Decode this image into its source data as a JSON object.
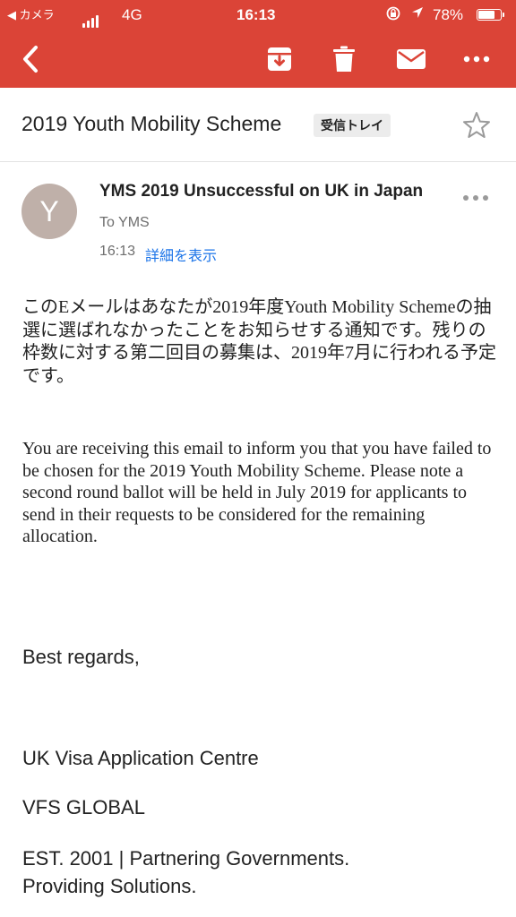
{
  "status_bar": {
    "back_app": "◀ カメラ",
    "network": "4G",
    "time": "16:13",
    "battery_pct": "78%",
    "battery_level": 0.78
  },
  "toolbar": {
    "icons": [
      "back-icon",
      "archive-icon",
      "trash-icon",
      "mail-icon",
      "more-horizontal-icon"
    ]
  },
  "email": {
    "subject": "2019 Youth Mobility Scheme",
    "label": "受信トレイ",
    "avatar_letter": "Y",
    "title": "YMS 2019 Unsuccessful on UK in Japan",
    "to": "To YMS",
    "time": "16:13",
    "details_link": "詳細を表示",
    "body_jp": "このEメールはあなたが2019年度Youth Mobility Schemeの抽選に選ばれなかったことをお知らせする通知です。残りの枠数に対する第二回目の募集は、2019年7月に行われる予定です。",
    "body_en": "You are receiving this email to inform you that you have failed to be chosen for the 2019 Youth Mobility Scheme. Please note a second round ballot will be held in July 2019 for applicants to send in their requests to be considered for the remaining allocation.",
    "regards": "Best regards,",
    "sign_centre": "UK Visa Application Centre",
    "sign_company": "VFS GLOBAL",
    "sign_tagline": "EST. 2001 | Partnering Governments. Providing Solutions."
  },
  "colors": {
    "header_red": "#db4437",
    "link_blue": "#1a73e8",
    "avatar_bg": "#bfb0a9"
  }
}
